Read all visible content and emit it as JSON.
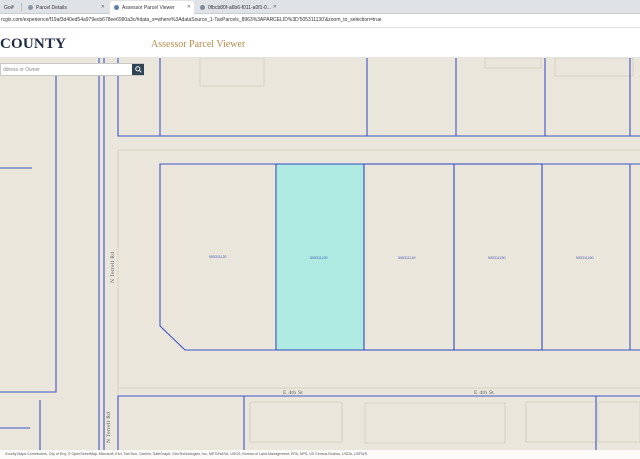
{
  "browser": {
    "tabs": [
      {
        "label": "Gov",
        "active": false
      },
      {
        "label": "Parcel Details",
        "active": false
      },
      {
        "label": "Assessor Parcel Viewer",
        "active": true
      },
      {
        "label": "0fbcb80f-a6b6-f011-a0f1-0...",
        "active": false
      }
    ],
    "url": "rcgis.com/experience/f19af3d40ed54a979ecb678ee6990a3c/#data_s=where%3AdataSource_1-TaxParcels_8963%3APARCELID%3D'505311130'&zoom_to_selection=true"
  },
  "header": {
    "county": "COUNTY",
    "app_title": "Assessor Parcel Viewer"
  },
  "search": {
    "placeholder": "ddress or Owner"
  },
  "map": {
    "selected_parcel": "505311130",
    "parcels": [
      {
        "id": "505311120"
      },
      {
        "id": "505311130"
      },
      {
        "id": "505311140"
      },
      {
        "id": "505311150"
      },
      {
        "id": "505311160"
      }
    ],
    "streets": {
      "n_terrell_upper": "N Terrell Rd",
      "n_terrell_lower": "N Terrell Rd",
      "e_4th_left": "E 4th St",
      "e_4th_right": "E 4th St"
    },
    "colors": {
      "parcel_line": "#3d55c4",
      "selected_fill": "#aee9e2",
      "background": "#eae6dc"
    }
  },
  "attribution": "County Maps Contributors, City of Eny, © OpenStreetMap, Microsoft, Esri, TomTom, Garmin, SafeGraph, GeoTechnologies, Inc, METI/NASA, USGS, Bureau of Land Management, EPA, NPS, US Census Bureau, USDA, USFWS"
}
